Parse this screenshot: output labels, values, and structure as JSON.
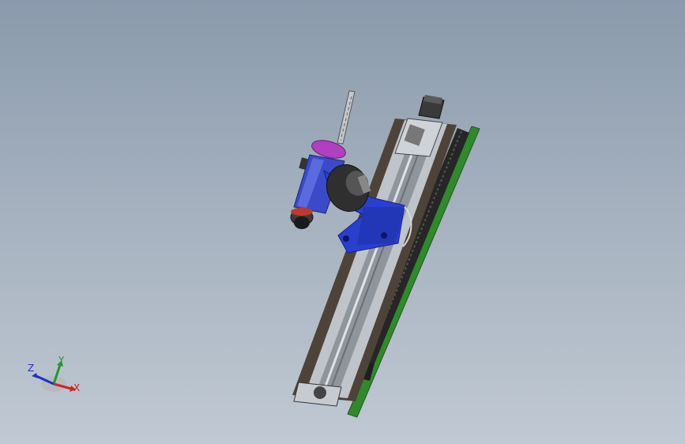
{
  "viewport": {
    "background_top": "#8a9aac",
    "background_bottom": "#c0c9d3"
  },
  "model": {
    "parts": [
      "linear-rail-body",
      "cable-drag-chain",
      "green-rail-base",
      "stepper-motor-top",
      "spindle-motor",
      "spindle-housing",
      "drill-bit",
      "magenta-collar",
      "blue-mount-bracket",
      "end-bracket-bottom"
    ],
    "colors": {
      "rail": "#5a5046",
      "rail_light": "#c8ccd2",
      "chain": "#2b2b2b",
      "green_rail": "#2f8a2a",
      "blue_part": "#2a3fd0",
      "magenta_part": "#b040c0",
      "motor": "#3a3a3a"
    }
  },
  "triad": {
    "x_label": "X",
    "y_label": "Y",
    "z_label": "Z",
    "x_color": "#d0231f",
    "y_color": "#1e9b2a",
    "z_color": "#2230c8"
  }
}
